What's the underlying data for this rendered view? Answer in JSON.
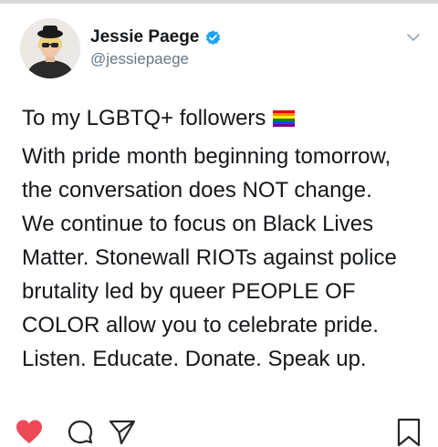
{
  "header": {
    "display_name": "Jessie Paege",
    "handle": "@jessiepaege"
  },
  "tweet": {
    "heading": "To my LGBTQ+ followers",
    "lines": [
      "With pride month beginning tomorrow,",
      "the conversation does NOT change.",
      "We continue to focus on Black Lives",
      "Matter. Stonewall RIOTs against police",
      "brutality led by queer PEOPLE OF",
      "COLOR allow you to celebrate pride.",
      "Listen. Educate. Donate. Speak up."
    ]
  },
  "icons": {
    "verified": "verified-badge-icon",
    "menu": "chevron-down-icon",
    "flag": "rainbow-flag-icon",
    "like": "heart-icon",
    "comment": "comment-icon",
    "share": "send-icon",
    "save": "bookmark-icon"
  },
  "colors": {
    "verified_blue": "#1da1f2",
    "like_red": "#ed4956",
    "secondary_text": "#657786"
  }
}
